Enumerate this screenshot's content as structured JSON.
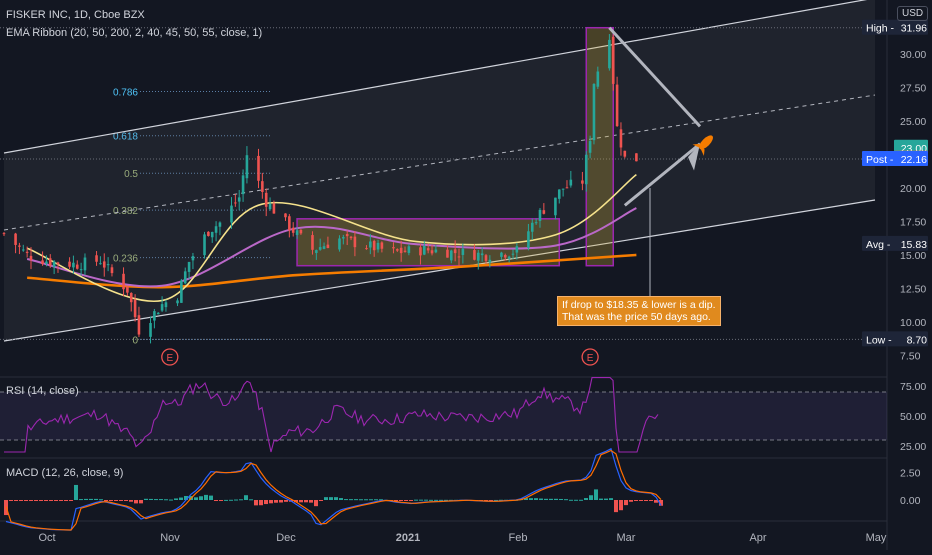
{
  "header": {
    "symbol_line": "FISKER INC, 1D, Cboe BZX",
    "indicator_line": "EMA Ribbon (20, 50, 200, 2, 40, 45, 50, 55, close, 1)",
    "currency": "USD"
  },
  "price_axis": {
    "ticks": [
      "30.00",
      "27.50",
      "25.00",
      "20.00",
      "17.50",
      "15.00",
      "12.50",
      "10.00",
      "7.50"
    ],
    "badges": [
      {
        "label": "High",
        "value": "31.96",
        "price": 31.96,
        "color": "#1e2538"
      },
      {
        "label": "",
        "value": "23.00",
        "price": 23.0,
        "color": "#26a69a"
      },
      {
        "label": "",
        "value": "22.18",
        "price": 22.18,
        "color": "#ef5350"
      },
      {
        "label": "Post",
        "value": "22.16",
        "price": 22.16,
        "color": "#2962ff"
      },
      {
        "label": "Avg",
        "value": "15.83",
        "price": 15.83,
        "color": "#1e2538"
      },
      {
        "label": "Low",
        "value": "8.70",
        "price": 8.7,
        "color": "#1e2538"
      }
    ]
  },
  "fib_levels": [
    {
      "label": "0.786",
      "price": 27.2
    },
    {
      "label": "0.618",
      "price": 23.9
    },
    {
      "label": "0.5",
      "price": 21.1
    },
    {
      "label": "0.382",
      "price": 18.35
    },
    {
      "label": "0.236",
      "price": 14.8
    },
    {
      "label": "0",
      "price": 8.7
    }
  ],
  "earnings_markers": [
    "E",
    "E"
  ],
  "annotation": {
    "line1": "If drop to $18.35 & lower is a dip.",
    "line2": "That was the price 50 days ago."
  },
  "rsi": {
    "title": "RSI (14, close)",
    "ticks": [
      "75.00",
      "50.00",
      "25.00"
    ],
    "overbought": 70,
    "oversold": 30
  },
  "macd": {
    "title": "MACD (12, 26, close, 9)",
    "ticks": [
      "2.50",
      "0.00"
    ]
  },
  "time_axis": {
    "labels": [
      "Oct",
      "Nov",
      "Dec",
      "2021",
      "Feb",
      "Mar",
      "Apr",
      "May"
    ]
  },
  "chart_data": {
    "type": "candlestick",
    "x_labels": [
      "Oct",
      "Nov",
      "Dec",
      "2021",
      "Feb",
      "Mar",
      "Apr",
      "May"
    ],
    "ylim": [
      7.5,
      32
    ],
    "close_series": [
      {
        "date": "2020-09-25",
        "close": 16.6
      },
      {
        "date": "2020-10-01",
        "close": 15.0
      },
      {
        "date": "2020-10-07",
        "close": 14.5
      },
      {
        "date": "2020-10-14",
        "close": 14.3
      },
      {
        "date": "2020-10-20",
        "close": 14.6
      },
      {
        "date": "2020-10-23",
        "close": 13.6
      },
      {
        "date": "2020-10-27",
        "close": 12.4
      },
      {
        "date": "2020-10-30",
        "close": 9.4
      },
      {
        "date": "2020-11-05",
        "close": 11.3
      },
      {
        "date": "2020-11-09",
        "close": 12.0
      },
      {
        "date": "2020-11-12",
        "close": 14.5
      },
      {
        "date": "2020-11-17",
        "close": 16.8
      },
      {
        "date": "2020-11-20",
        "close": 17.4
      },
      {
        "date": "2020-11-25",
        "close": 19.3
      },
      {
        "date": "2020-11-27",
        "close": 22.5
      },
      {
        "date": "2020-12-02",
        "close": 19.0
      },
      {
        "date": "2020-12-07",
        "close": 17.4
      },
      {
        "date": "2020-12-14",
        "close": 15.4
      },
      {
        "date": "2020-12-21",
        "close": 16.2
      },
      {
        "date": "2021-01-04",
        "close": 15.2
      },
      {
        "date": "2021-01-12",
        "close": 15.4
      },
      {
        "date": "2021-01-20",
        "close": 15.2
      },
      {
        "date": "2021-01-28",
        "close": 15.0
      },
      {
        "date": "2021-02-05",
        "close": 15.3
      },
      {
        "date": "2021-02-10",
        "close": 17.8
      },
      {
        "date": "2021-02-17",
        "close": 20.0
      },
      {
        "date": "2021-02-22",
        "close": 20.5
      },
      {
        "date": "2021-02-24",
        "close": 23.8
      },
      {
        "date": "2021-02-25",
        "close": 27.9
      },
      {
        "date": "2021-03-01",
        "close": 31.5
      },
      {
        "date": "2021-03-03",
        "close": 24.5
      },
      {
        "date": "2021-03-05",
        "close": 22.2
      },
      {
        "date": "2021-03-08",
        "close": 22.18
      }
    ],
    "ema_ribbon": {
      "ema20": [
        [
          "2020-10-01",
          15.5
        ],
        [
          "2020-11-05",
          11.6
        ],
        [
          "2020-12-01",
          18.8
        ],
        [
          "2021-01-10",
          16.0
        ],
        [
          "2021-02-15",
          16.5
        ],
        [
          "2021-03-08",
          21.0
        ]
      ],
      "ema50": [
        [
          "2020-10-01",
          14.7
        ],
        [
          "2020-11-05",
          12.7
        ],
        [
          "2020-12-10",
          17.0
        ],
        [
          "2021-01-10",
          15.8
        ],
        [
          "2021-02-15",
          15.7
        ],
        [
          "2021-03-08",
          18.5
        ]
      ],
      "ema200": [
        [
          "2020-10-01",
          13.3
        ],
        [
          "2020-11-05",
          12.6
        ],
        [
          "2020-12-10",
          13.5
        ],
        [
          "2021-01-20",
          14.1
        ],
        [
          "2021-03-08",
          15.0
        ]
      ]
    }
  }
}
